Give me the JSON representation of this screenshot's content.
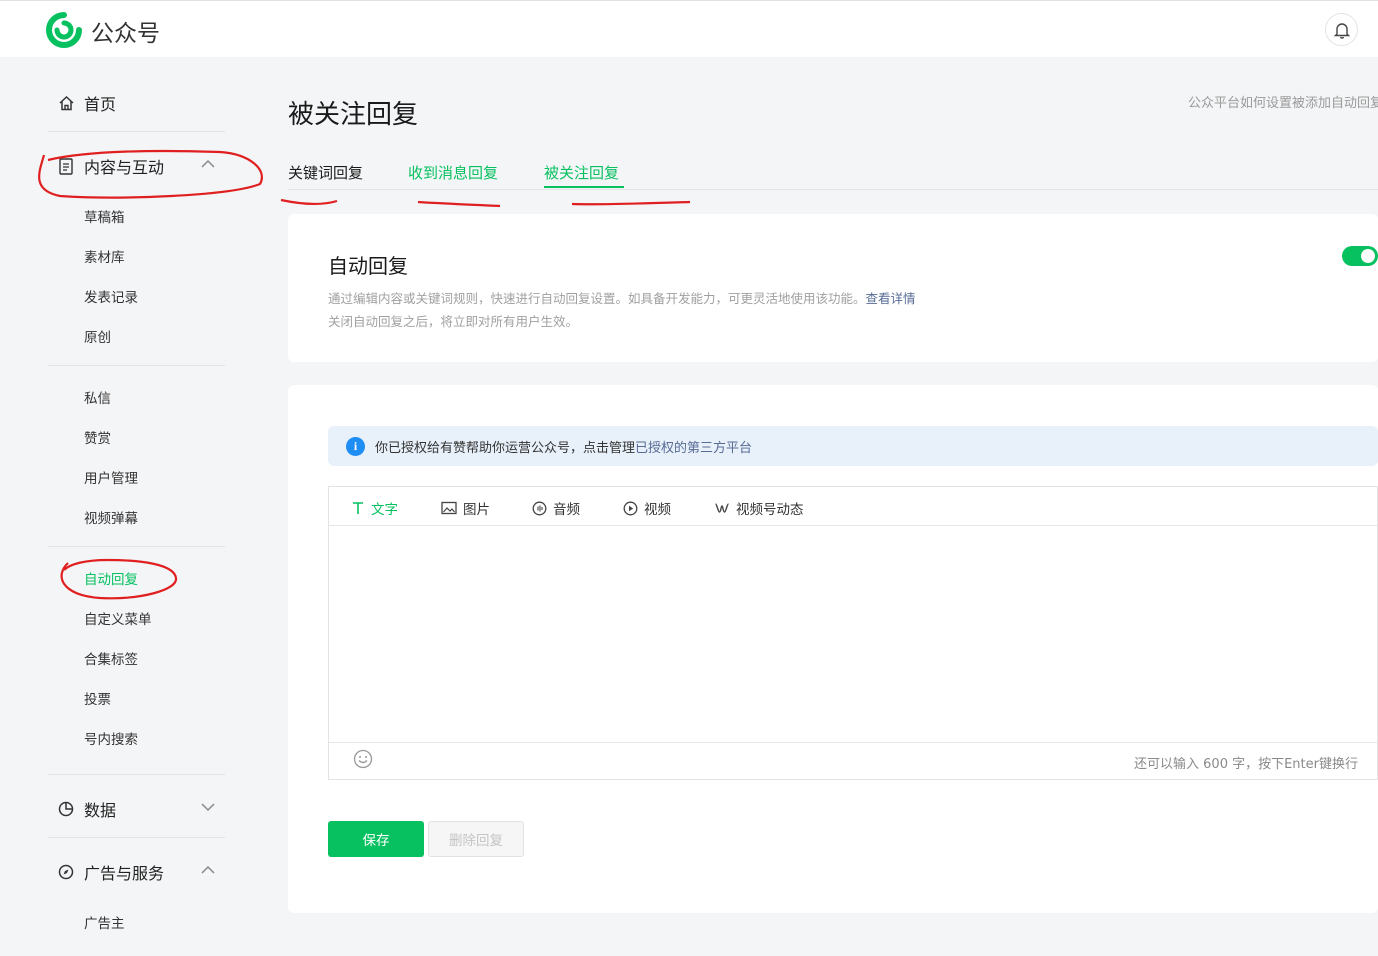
{
  "header": {
    "brand": "公众号",
    "icons": [
      "logo-icon",
      "bell-icon"
    ]
  },
  "sidebar": {
    "home": "首页",
    "content_section": "内容与互动",
    "content_items": [
      "草稿箱",
      "素材库",
      "发表记录",
      "原创"
    ],
    "interaction_items": [
      "私信",
      "赞赏",
      "用户管理",
      "视频弹幕"
    ],
    "feature_items": [
      "自动回复",
      "自定义菜单",
      "合集标签",
      "投票",
      "号内搜索"
    ],
    "data_section": "数据",
    "ads_section": "广告与服务",
    "ads_items": [
      "广告主"
    ]
  },
  "main": {
    "title": "被关注回复",
    "help_link": "公众平台如何设置被添加自动回复",
    "tabs": [
      "关键词回复",
      "收到消息回复",
      "被关注回复"
    ],
    "auto_reply": {
      "title": "自动回复",
      "desc_line1": "通过编辑内容或关键词规则，快速进行自动回复设置。如具备开发能力，可更灵活地使用该功能。",
      "desc_link": "查看详情",
      "desc_line2": "关闭自动回复之后，将立即对所有用户生效。",
      "enabled": true
    },
    "notice": {
      "text": "你已授权给有赞帮助你运营公众号，点击管理",
      "link": "已授权的第三方平台"
    },
    "editor_tabs": [
      "文字",
      "图片",
      "音频",
      "视频",
      "视频号动态"
    ],
    "counter": "还可以输入 600 字，按下Enter键换行",
    "save_button": "保存",
    "delete_button": "删除回复"
  },
  "colors": {
    "accent": "#07c160",
    "link": "#576b95",
    "annotation": "#e02020",
    "info": "#1e8ef5"
  }
}
